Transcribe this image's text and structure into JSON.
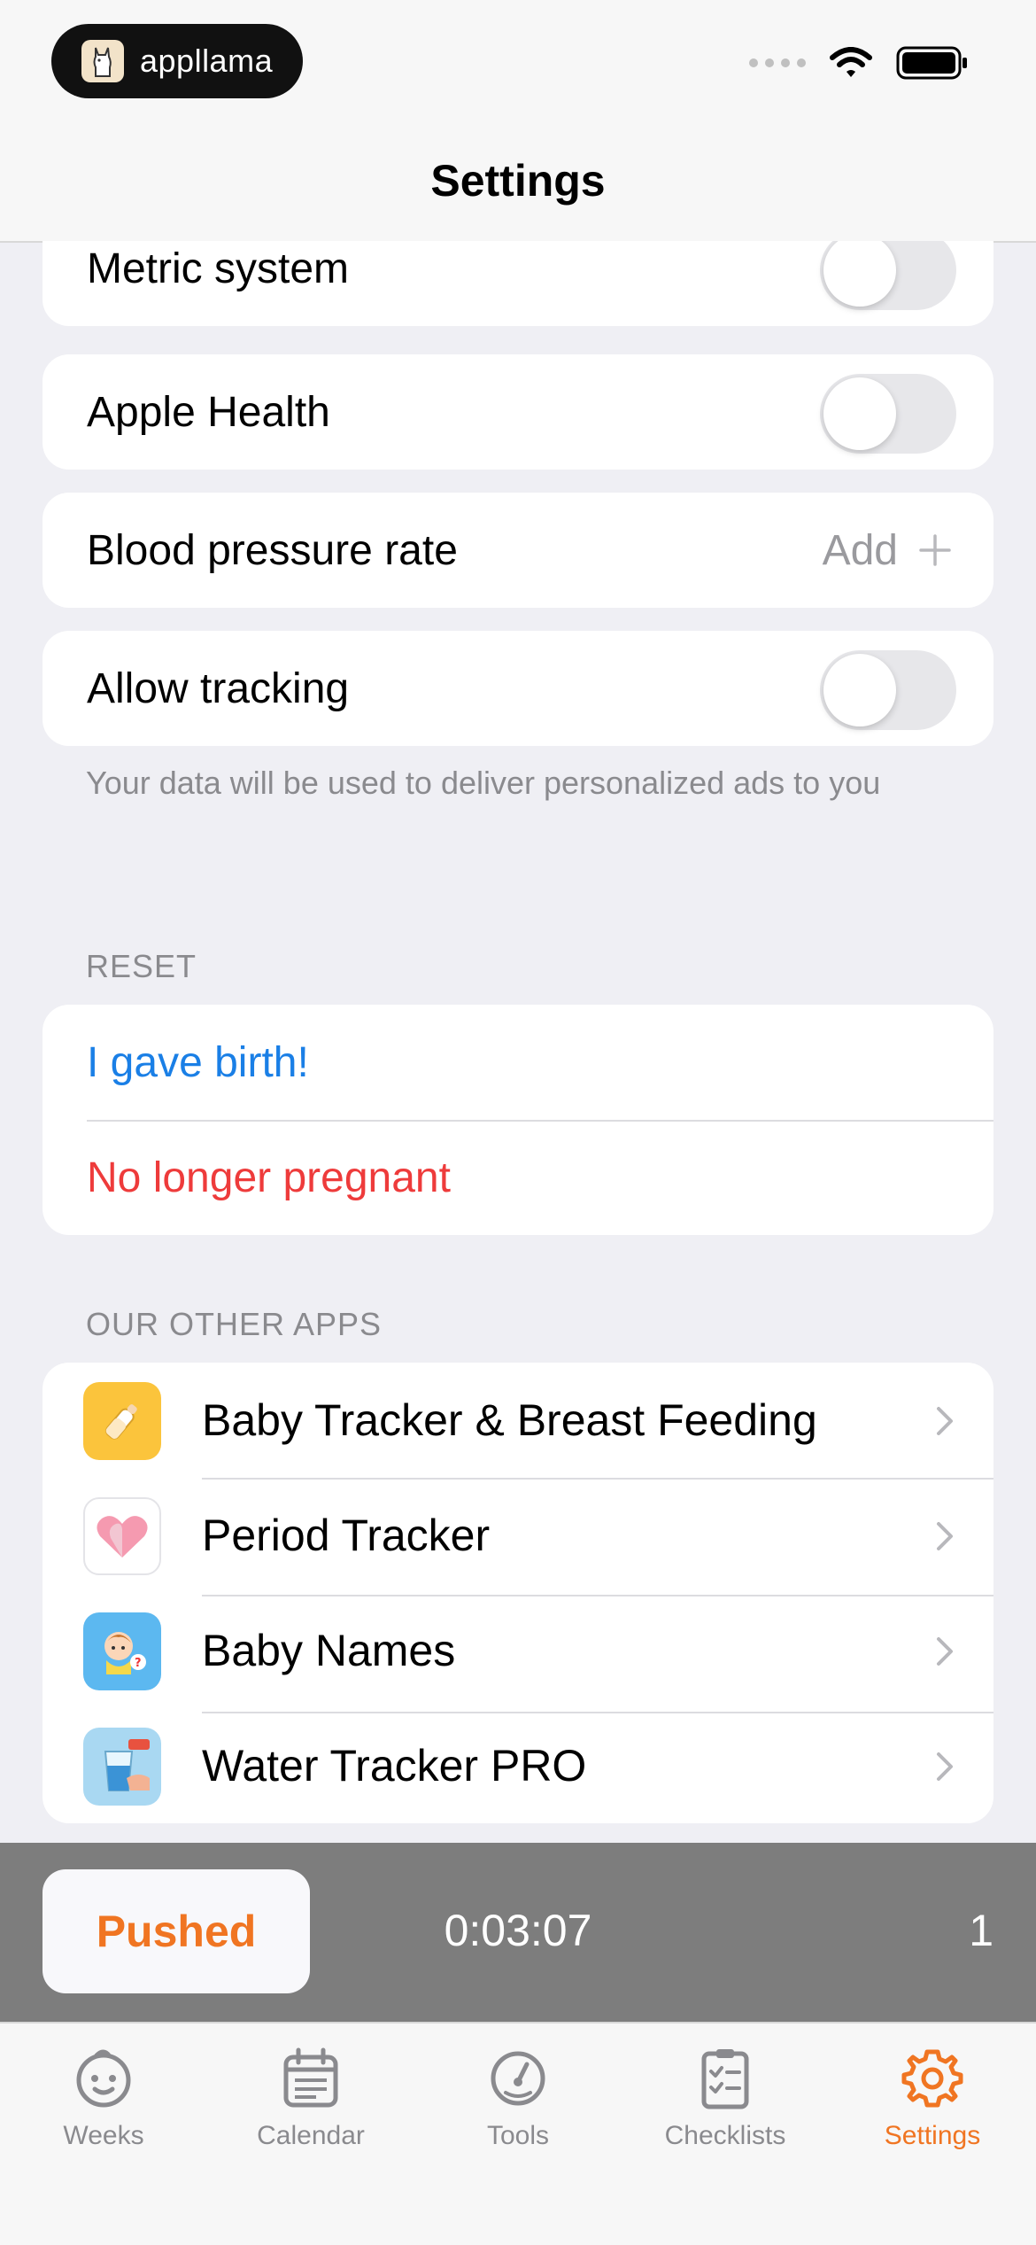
{
  "status": {
    "brand": "appllama"
  },
  "nav": {
    "title": "Settings"
  },
  "settings": {
    "metric_label": "Metric system",
    "apple_health_label": "Apple Health",
    "blood_pressure_label": "Blood pressure rate",
    "blood_pressure_action": "Add",
    "tracking_label": "Allow tracking",
    "tracking_footnote": "Your data will be used to deliver personalized ads to you"
  },
  "reset": {
    "header": "RESET",
    "gave_birth": "I gave birth!",
    "no_longer": "No longer pregnant"
  },
  "other_apps": {
    "header": "OUR OTHER APPS",
    "items": [
      {
        "label": "Baby Tracker & Breast Feeding",
        "icon": "bottle-icon"
      },
      {
        "label": "Period Tracker",
        "icon": "heart-icon"
      },
      {
        "label": "Baby Names",
        "icon": "baby-icon"
      },
      {
        "label": "Water Tracker PRO",
        "icon": "water-glass-icon"
      }
    ]
  },
  "timer": {
    "button": "Pushed",
    "elapsed": "0:03:07",
    "count": "1"
  },
  "tabs": [
    {
      "label": "Weeks",
      "icon": "baby-face-icon"
    },
    {
      "label": "Calendar",
      "icon": "calendar-icon"
    },
    {
      "label": "Tools",
      "icon": "gauge-icon"
    },
    {
      "label": "Checklists",
      "icon": "checklist-icon"
    },
    {
      "label": "Settings",
      "icon": "gear-icon",
      "active": true
    }
  ],
  "colors": {
    "accent": "#f07522",
    "link_blue": "#1a7fe6",
    "destructive_red": "#ee3b3b",
    "background": "#efeff4"
  }
}
